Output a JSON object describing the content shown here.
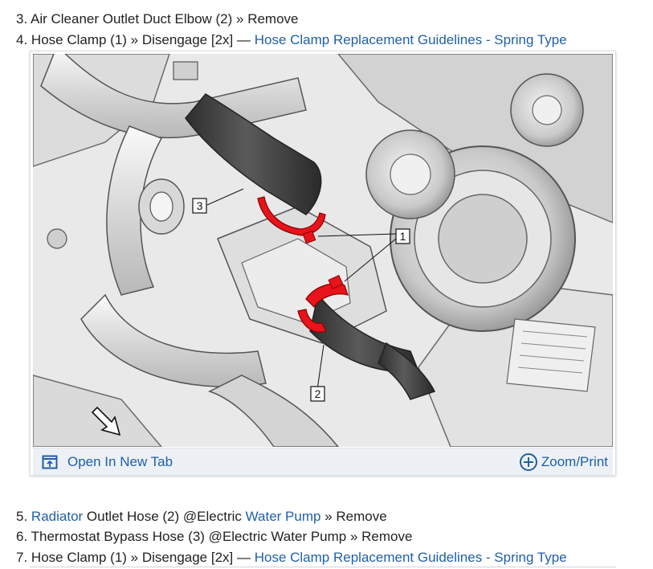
{
  "steps": [
    {
      "number": "3.",
      "text_before": "Air Cleaner Outlet Duct Elbow (2) » Remove"
    },
    {
      "number": "4.",
      "text_before": "Hose Clamp (1) » Disengage [2x] — ",
      "link": "Hose Clamp Replacement Guidelines - Spring Type"
    },
    {
      "number": "5.",
      "link": "Radiator",
      "text_middle": " Outlet Hose (2) @Electric ",
      "link2": "Water Pump",
      "text_after": " » Remove"
    },
    {
      "number": "6.",
      "text_before": "Thermostat Bypass Hose (3) @Electric Water Pump » Remove"
    },
    {
      "number": "7.",
      "text_before": "Hose Clamp (1) » Disengage [2x] — ",
      "link": "Hose Clamp Replacement Guidelines - Spring Type"
    }
  ],
  "figure": {
    "callouts": [
      "3",
      "1",
      "2"
    ],
    "toolbar": {
      "open_new_tab": "Open In New Tab",
      "zoom_print": "Zoom/Print"
    }
  },
  "colors": {
    "link": "#1f5fa8",
    "clamp_red": "#e8131b",
    "hose_dark": "#4a4a4a"
  }
}
